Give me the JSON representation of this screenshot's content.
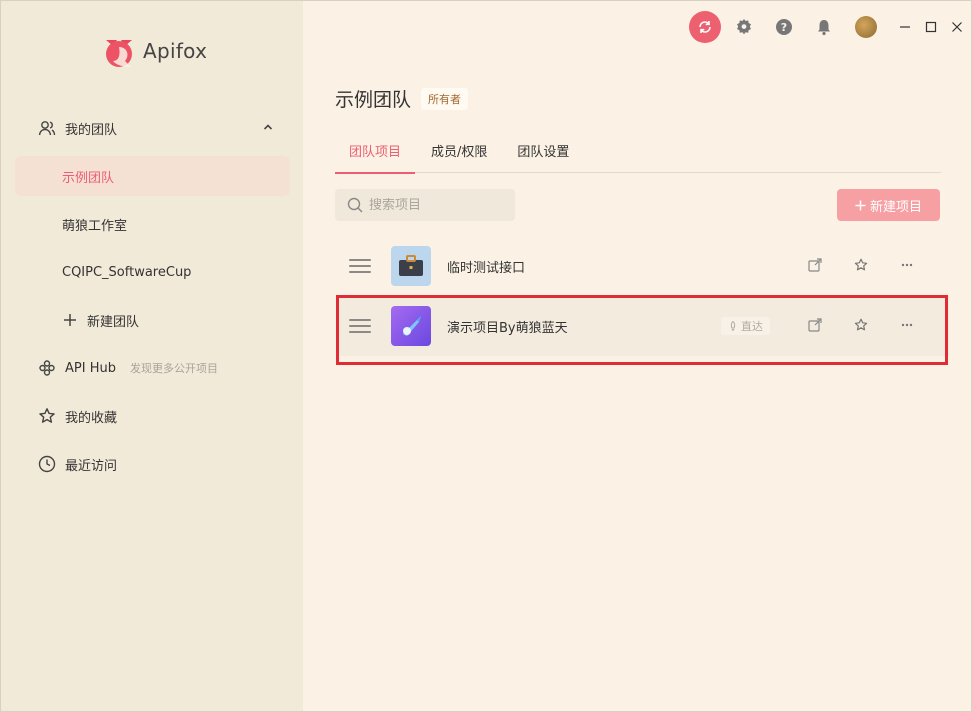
{
  "app": {
    "name": "Apifox",
    "accent": "#ec5e73"
  },
  "sidebar": {
    "my_teams_label": "我的团队",
    "teams": [
      {
        "label": "示例团队",
        "active": true
      },
      {
        "label": "萌狼工作室",
        "active": false
      },
      {
        "label": "CQIPC_SoftwareCup",
        "active": false
      }
    ],
    "new_team_label": "新建团队",
    "api_hub": {
      "label": "API Hub",
      "hint": "发现更多公开项目"
    },
    "favorites_label": "我的收藏",
    "recent_label": "最近访问"
  },
  "topbar": {
    "icons": [
      "sync-icon",
      "gear-icon",
      "help-icon",
      "bell-icon",
      "avatar",
      "minimize-icon",
      "maximize-icon",
      "close-icon"
    ]
  },
  "team": {
    "title": "示例团队",
    "role_badge": "所有者",
    "tabs": [
      "团队项目",
      "成员/权限",
      "团队设置"
    ],
    "active_tab": "团队项目"
  },
  "search": {
    "placeholder": "搜索项目",
    "value": ""
  },
  "new_project_label": "新建项目",
  "projects": [
    {
      "name": "临时测试接口",
      "icon": "briefcase-icon",
      "badge": ""
    },
    {
      "name": "演示项目By萌狼蓝天",
      "icon": "rocket-icon",
      "badge": "直达"
    }
  ]
}
